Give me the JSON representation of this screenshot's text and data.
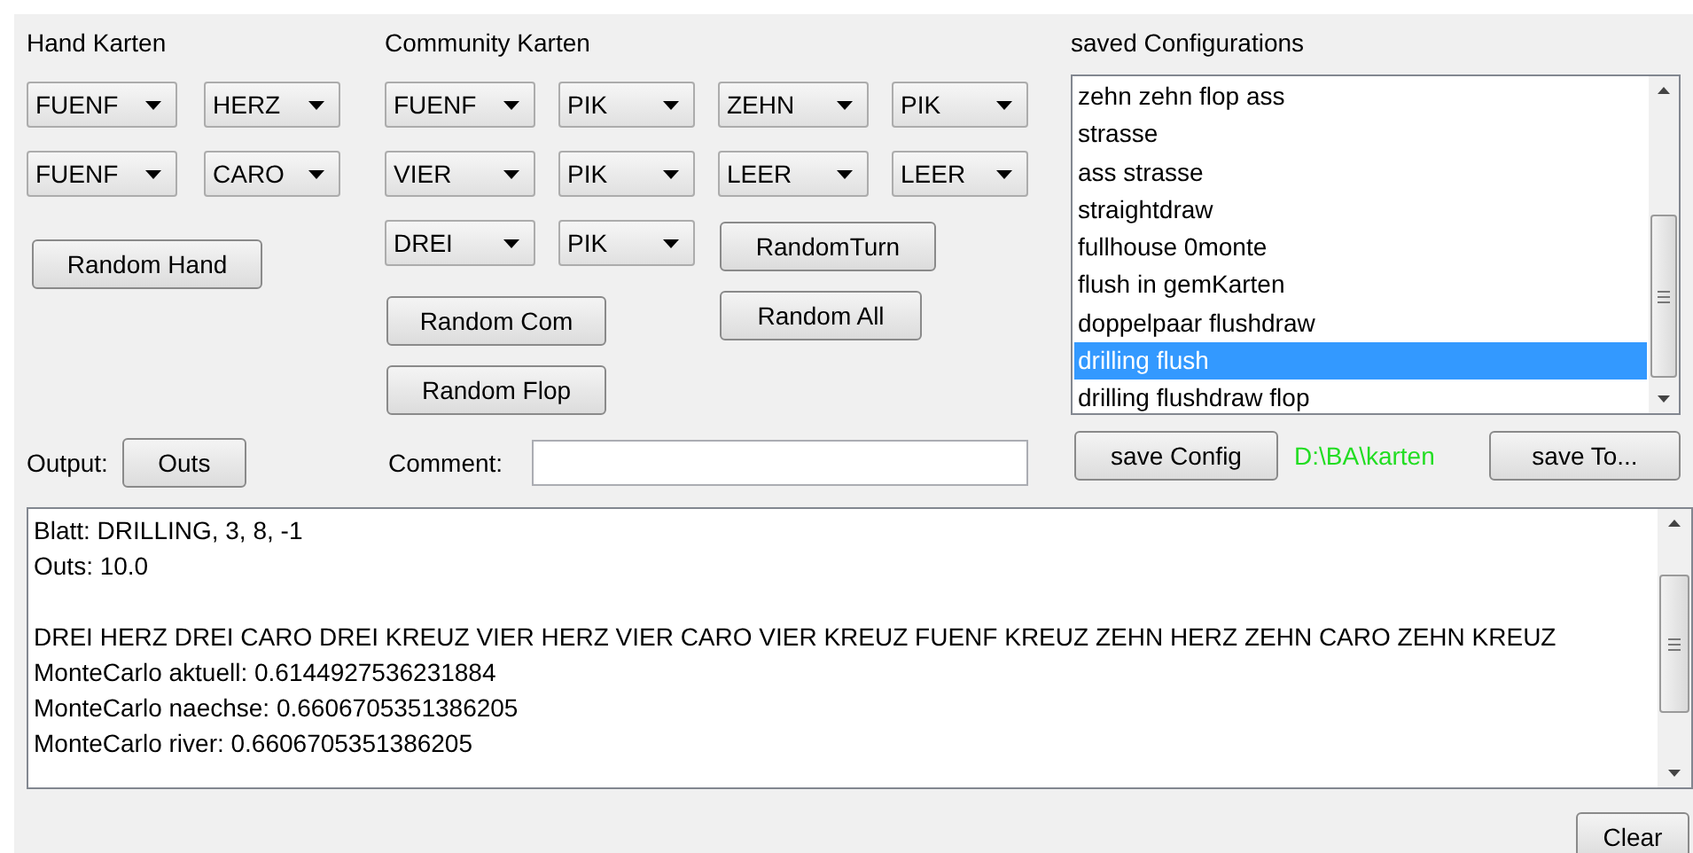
{
  "hand_panel": {
    "title": "Hand Karten",
    "rows": [
      [
        "FUENF",
        "HERZ"
      ],
      [
        "FUENF",
        "CARO"
      ]
    ],
    "random_button": "Random Hand"
  },
  "community_panel": {
    "title": "Community Karten",
    "rows": [
      [
        "FUENF",
        "PIK",
        "ZEHN",
        "PIK"
      ],
      [
        "VIER",
        "PIK",
        "LEER",
        "LEER"
      ],
      [
        "DREI",
        "PIK"
      ]
    ],
    "buttons": [
      "RandomTurn",
      "Random Com",
      "Random All",
      "Random Flop"
    ]
  },
  "output_row": {
    "label": "Output:",
    "button": "Outs"
  },
  "comment": {
    "label": "Comment:"
  },
  "saved_configurations": {
    "title": "saved Configurations",
    "items": [
      {
        "label": "zehn zehn flop ass",
        "selected": false
      },
      {
        "label": "strasse",
        "selected": false
      },
      {
        "label": "ass strasse",
        "selected": false
      },
      {
        "label": "straightdraw",
        "selected": false
      },
      {
        "label": "fullhouse 0monte",
        "selected": false
      },
      {
        "label": "flush in gemKarten",
        "selected": false
      },
      {
        "label": "doppelpaar flushdraw",
        "selected": false
      },
      {
        "label": "drilling flush",
        "selected": true
      },
      {
        "label": "drilling flushdraw flop",
        "selected": false
      }
    ],
    "save_button": "save Config",
    "path": "D:\\BA\\karten",
    "save_to_button": "save To..."
  },
  "output": {
    "text": "Blatt: DRILLING, 3, 8, -1\nOuts: 10.0\n\nDREI HERZ DREI CARO DREI KREUZ VIER HERZ VIER CARO VIER KREUZ FUENF KREUZ ZEHN HERZ ZEHN CARO ZEHN KREUZ\nMonteCarlo aktuell: 0.6144927536231884\nMonteCarlo naechse: 0.6606705351386205\nMonteCarlo river: 0.6606705351386205"
  },
  "clear_button": "Clear"
}
